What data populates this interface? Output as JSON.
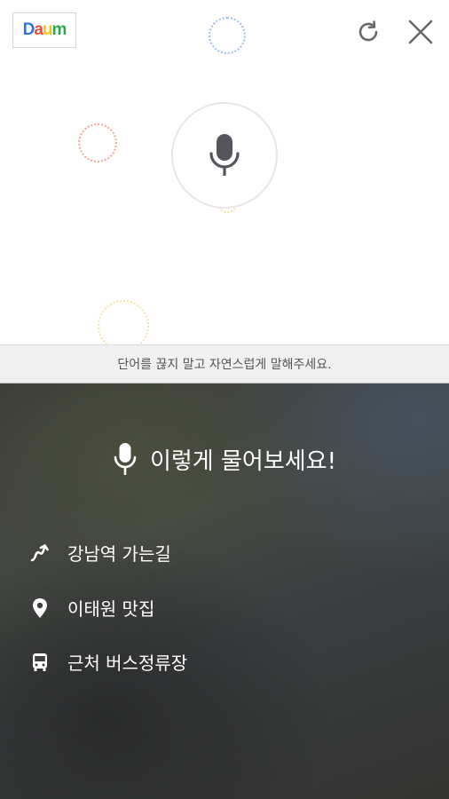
{
  "logo": {
    "text": "Daum",
    "letters": [
      "D",
      "a",
      "u",
      "m"
    ],
    "colors": [
      "#2b76e6",
      "#f04a3a",
      "#fbbf16",
      "#2ba84a"
    ]
  },
  "header": {
    "refresh_icon": "refresh-icon",
    "close_icon": "close-icon"
  },
  "voice": {
    "mic_icon": "microphone-icon"
  },
  "hint": {
    "text": "단어를 끊지 말고 자연스럽게 말해주세요."
  },
  "examples": {
    "title": "이렇게 물어보세요!",
    "items": [
      {
        "icon": "route-icon",
        "label": "강남역 가는길"
      },
      {
        "icon": "location-pin-icon",
        "label": "이태원 맛집"
      },
      {
        "icon": "bus-icon",
        "label": "근처 버스정류장"
      }
    ]
  },
  "colors": {
    "accent_blue": "#8fb0ea",
    "accent_red": "#f0a090",
    "accent_yellow": "#f2e2a0",
    "dark_panel": "#3f413d"
  }
}
